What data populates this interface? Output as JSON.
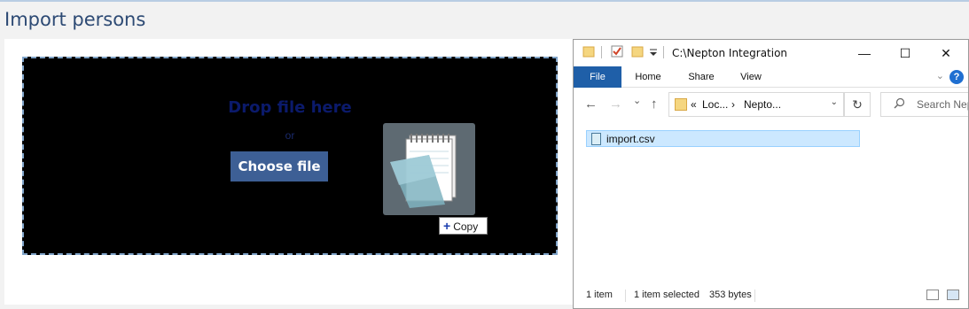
{
  "page": {
    "title": "Import persons"
  },
  "dropzone": {
    "drop_text": "Drop file here",
    "or_text": "or",
    "choose_label": "Choose file"
  },
  "drag": {
    "tooltip_icon": "+",
    "tooltip_text": "Copy"
  },
  "explorer": {
    "title": "C:\\Nepton Integration",
    "window_buttons": {
      "minimize": "—",
      "maximize": "☐",
      "close": "✕"
    },
    "ribbon": {
      "tabs": [
        "File",
        "Home",
        "Share",
        "View"
      ],
      "help": "?",
      "collapse": "⌄"
    },
    "nav": {
      "back": "←",
      "forward": "→",
      "recent": "⌄",
      "up": "↑"
    },
    "address": {
      "overflow": "«",
      "crumbs": [
        "Loc...",
        "Nepto..."
      ],
      "separator": "›",
      "dropdown": "⌄",
      "refresh": "↻"
    },
    "search": {
      "placeholder": "Search Nep"
    },
    "files": [
      {
        "name": "import.csv",
        "selected": true
      }
    ],
    "status": {
      "count": "1 item",
      "selected": "1 item selected",
      "size": "353 bytes"
    }
  },
  "colors": {
    "accent": "#3d5f95",
    "title": "#2d4a74",
    "selection": "#cce8ff",
    "file_tab": "#1f5fa8"
  }
}
